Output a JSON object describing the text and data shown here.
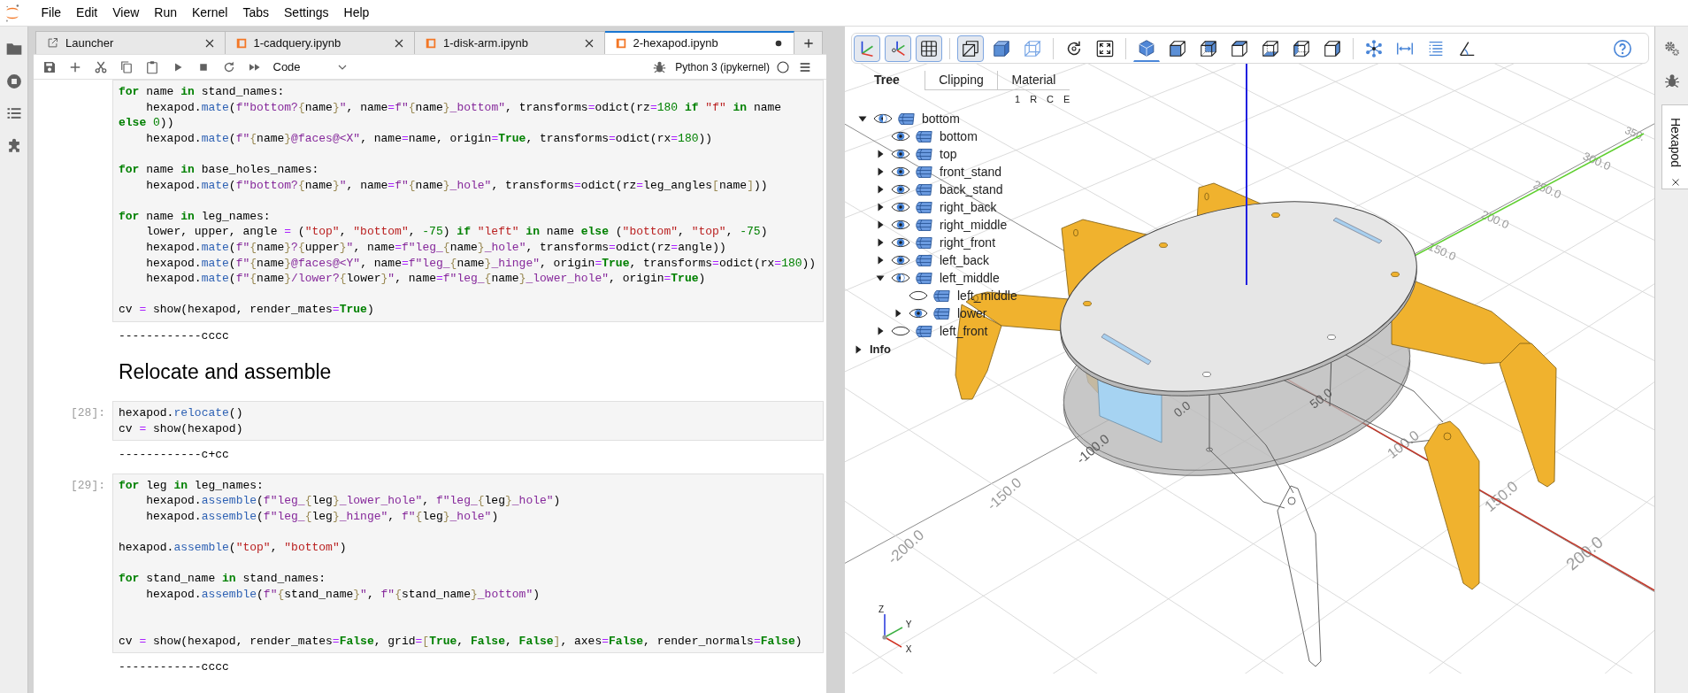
{
  "menu_bar": {
    "items": [
      "File",
      "Edit",
      "View",
      "Run",
      "Kernel",
      "Tabs",
      "Settings",
      "Help"
    ]
  },
  "left_sidebar": {
    "items": [
      {
        "kind": "files",
        "selected": false
      },
      {
        "kind": "running",
        "selected": false
      },
      {
        "kind": "toc",
        "selected": false
      },
      {
        "kind": "extensions",
        "selected": false
      }
    ]
  },
  "notebook_tabs": [
    {
      "kind": "launcher",
      "label": "Launcher",
      "selected": false,
      "modified": false
    },
    {
      "kind": "notebook",
      "label": "1-cadquery.ipynb",
      "selected": false,
      "modified": false
    },
    {
      "kind": "notebook",
      "label": "1-disk-arm.ipynb",
      "selected": false,
      "modified": false
    },
    {
      "kind": "notebook",
      "label": "2-hexapod.ipynb",
      "selected": true,
      "modified": true
    }
  ],
  "notebook_toolbar": {
    "cell_type": "Code",
    "kernel": {
      "name": "Python 3 (ipykernel)",
      "busy": false
    }
  },
  "cells": [
    {
      "kind": "code",
      "code": [
        {
          "kind": "keyword",
          "text": "for"
        },
        {
          "kind": "plain",
          "text": " name "
        },
        {
          "kind": "keyword",
          "text": "in"
        },
        {
          "kind": "plain",
          "text": " stand_names:\n    hexapod."
        },
        {
          "kind": "property",
          "text": "mate"
        },
        {
          "kind": "plain",
          "text": "("
        },
        {
          "kind": "fstring",
          "text": "f\"bottom?"
        },
        {
          "kind": "brace",
          "text": "{"
        },
        {
          "kind": "plain",
          "text": "name"
        },
        {
          "kind": "brace",
          "text": "}"
        },
        {
          "kind": "fstring",
          "text": "\""
        },
        {
          "kind": "plain",
          "text": ", name"
        },
        {
          "kind": "operator",
          "text": "="
        },
        {
          "kind": "fstring",
          "text": "f\""
        },
        {
          "kind": "brace",
          "text": "{"
        },
        {
          "kind": "plain",
          "text": "name"
        },
        {
          "kind": "brace",
          "text": "}"
        },
        {
          "kind": "fstring",
          "text": "_bottom\""
        },
        {
          "kind": "plain",
          "text": ", transforms"
        },
        {
          "kind": "operator",
          "text": "="
        },
        {
          "kind": "plain",
          "text": "odict(rz"
        },
        {
          "kind": "operator",
          "text": "="
        },
        {
          "kind": "number",
          "text": "180"
        },
        {
          "kind": "keyword",
          "text": " if "
        },
        {
          "kind": "string",
          "text": "\"f\""
        },
        {
          "kind": "keyword",
          "text": " in"
        },
        {
          "kind": "plain",
          "text": " name\n"
        },
        {
          "kind": "keyword",
          "text": "else "
        },
        {
          "kind": "number",
          "text": "0"
        },
        {
          "kind": "plain",
          "text": "))\n    hexapod."
        },
        {
          "kind": "property",
          "text": "mate"
        },
        {
          "kind": "plain",
          "text": "("
        },
        {
          "kind": "fstring",
          "text": "f\""
        },
        {
          "kind": "brace",
          "text": "{"
        },
        {
          "kind": "plain",
          "text": "name"
        },
        {
          "kind": "brace",
          "text": "}"
        },
        {
          "kind": "fstring",
          "text": "@faces@<X\""
        },
        {
          "kind": "plain",
          "text": ", name"
        },
        {
          "kind": "operator",
          "text": "="
        },
        {
          "kind": "plain",
          "text": "name, origin"
        },
        {
          "kind": "operator",
          "text": "="
        },
        {
          "kind": "keyword",
          "text": "True"
        },
        {
          "kind": "plain",
          "text": ", transforms"
        },
        {
          "kind": "operator",
          "text": "="
        },
        {
          "kind": "plain",
          "text": "odict(rx"
        },
        {
          "kind": "operator",
          "text": "="
        },
        {
          "kind": "number",
          "text": "180"
        },
        {
          "kind": "plain",
          "text": "))\n\n"
        },
        {
          "kind": "keyword",
          "text": "for"
        },
        {
          "kind": "plain",
          "text": " name "
        },
        {
          "kind": "keyword",
          "text": "in"
        },
        {
          "kind": "plain",
          "text": " base_holes_names:\n    hexapod."
        },
        {
          "kind": "property",
          "text": "mate"
        },
        {
          "kind": "plain",
          "text": "("
        },
        {
          "kind": "fstring",
          "text": "f\"bottom?"
        },
        {
          "kind": "brace",
          "text": "{"
        },
        {
          "kind": "plain",
          "text": "name"
        },
        {
          "kind": "brace",
          "text": "}"
        },
        {
          "kind": "fstring",
          "text": "\""
        },
        {
          "kind": "plain",
          "text": ", name"
        },
        {
          "kind": "operator",
          "text": "="
        },
        {
          "kind": "fstring",
          "text": "f\""
        },
        {
          "kind": "brace",
          "text": "{"
        },
        {
          "kind": "plain",
          "text": "name"
        },
        {
          "kind": "brace",
          "text": "}"
        },
        {
          "kind": "fstring",
          "text": "_hole\""
        },
        {
          "kind": "plain",
          "text": ", transforms"
        },
        {
          "kind": "operator",
          "text": "="
        },
        {
          "kind": "plain",
          "text": "odict(rz"
        },
        {
          "kind": "operator",
          "text": "="
        },
        {
          "kind": "plain",
          "text": "leg_angles"
        },
        {
          "kind": "brace",
          "text": "["
        },
        {
          "kind": "plain",
          "text": "name"
        },
        {
          "kind": "brace",
          "text": "]"
        },
        {
          "kind": "plain",
          "text": "))\n\n"
        },
        {
          "kind": "keyword",
          "text": "for"
        },
        {
          "kind": "plain",
          "text": " name "
        },
        {
          "kind": "keyword",
          "text": "in"
        },
        {
          "kind": "plain",
          "text": " leg_names:\n    lower, upper, angle "
        },
        {
          "kind": "operator",
          "text": "="
        },
        {
          "kind": "plain",
          "text": " ("
        },
        {
          "kind": "string",
          "text": "\"top\""
        },
        {
          "kind": "plain",
          "text": ", "
        },
        {
          "kind": "string",
          "text": "\"bottom\""
        },
        {
          "kind": "plain",
          "text": ", "
        },
        {
          "kind": "number",
          "text": "-75"
        },
        {
          "kind": "plain",
          "text": ") "
        },
        {
          "kind": "keyword",
          "text": "if "
        },
        {
          "kind": "string",
          "text": "\"left\""
        },
        {
          "kind": "keyword",
          "text": " in"
        },
        {
          "kind": "plain",
          "text": " name "
        },
        {
          "kind": "keyword",
          "text": "else"
        },
        {
          "kind": "plain",
          "text": " ("
        },
        {
          "kind": "string",
          "text": "\"bottom\""
        },
        {
          "kind": "plain",
          "text": ", "
        },
        {
          "kind": "string",
          "text": "\"top\""
        },
        {
          "kind": "plain",
          "text": ", "
        },
        {
          "kind": "number",
          "text": "-75"
        },
        {
          "kind": "plain",
          "text": ")\n    hexapod."
        },
        {
          "kind": "property",
          "text": "mate"
        },
        {
          "kind": "plain",
          "text": "("
        },
        {
          "kind": "fstring",
          "text": "f\""
        },
        {
          "kind": "brace",
          "text": "{"
        },
        {
          "kind": "plain",
          "text": "name"
        },
        {
          "kind": "brace",
          "text": "}"
        },
        {
          "kind": "fstring",
          "text": "?"
        },
        {
          "kind": "brace",
          "text": "{"
        },
        {
          "kind": "plain",
          "text": "upper"
        },
        {
          "kind": "brace",
          "text": "}"
        },
        {
          "kind": "fstring",
          "text": "\""
        },
        {
          "kind": "plain",
          "text": ", name"
        },
        {
          "kind": "operator",
          "text": "="
        },
        {
          "kind": "fstring",
          "text": "f\"leg_"
        },
        {
          "kind": "brace",
          "text": "{"
        },
        {
          "kind": "plain",
          "text": "name"
        },
        {
          "kind": "brace",
          "text": "}"
        },
        {
          "kind": "fstring",
          "text": "_hole\""
        },
        {
          "kind": "plain",
          "text": ", transforms"
        },
        {
          "kind": "operator",
          "text": "="
        },
        {
          "kind": "plain",
          "text": "odict(rz"
        },
        {
          "kind": "operator",
          "text": "="
        },
        {
          "kind": "plain",
          "text": "angle))\n    hexapod."
        },
        {
          "kind": "property",
          "text": "mate"
        },
        {
          "kind": "plain",
          "text": "("
        },
        {
          "kind": "fstring",
          "text": "f\""
        },
        {
          "kind": "brace",
          "text": "{"
        },
        {
          "kind": "plain",
          "text": "name"
        },
        {
          "kind": "brace",
          "text": "}"
        },
        {
          "kind": "fstring",
          "text": "@faces@<Y\""
        },
        {
          "kind": "plain",
          "text": ", name"
        },
        {
          "kind": "operator",
          "text": "="
        },
        {
          "kind": "fstring",
          "text": "f\"leg_"
        },
        {
          "kind": "brace",
          "text": "{"
        },
        {
          "kind": "plain",
          "text": "name"
        },
        {
          "kind": "brace",
          "text": "}"
        },
        {
          "kind": "fstring",
          "text": "_hinge\""
        },
        {
          "kind": "plain",
          "text": ", origin"
        },
        {
          "kind": "operator",
          "text": "="
        },
        {
          "kind": "keyword",
          "text": "True"
        },
        {
          "kind": "plain",
          "text": ", transforms"
        },
        {
          "kind": "operator",
          "text": "="
        },
        {
          "kind": "plain",
          "text": "odict(rx"
        },
        {
          "kind": "operator",
          "text": "="
        },
        {
          "kind": "number",
          "text": "180"
        },
        {
          "kind": "plain",
          "text": "))\n    hexapod."
        },
        {
          "kind": "property",
          "text": "mate"
        },
        {
          "kind": "plain",
          "text": "("
        },
        {
          "kind": "fstring",
          "text": "f\""
        },
        {
          "kind": "brace",
          "text": "{"
        },
        {
          "kind": "plain",
          "text": "name"
        },
        {
          "kind": "brace",
          "text": "}"
        },
        {
          "kind": "fstring",
          "text": "/lower?"
        },
        {
          "kind": "brace",
          "text": "{"
        },
        {
          "kind": "plain",
          "text": "lower"
        },
        {
          "kind": "brace",
          "text": "}"
        },
        {
          "kind": "fstring",
          "text": "\""
        },
        {
          "kind": "plain",
          "text": ", name"
        },
        {
          "kind": "operator",
          "text": "="
        },
        {
          "kind": "fstring",
          "text": "f\"leg_"
        },
        {
          "kind": "brace",
          "text": "{"
        },
        {
          "kind": "plain",
          "text": "name"
        },
        {
          "kind": "brace",
          "text": "}"
        },
        {
          "kind": "fstring",
          "text": "_lower_hole\""
        },
        {
          "kind": "plain",
          "text": ", origin"
        },
        {
          "kind": "operator",
          "text": "="
        },
        {
          "kind": "keyword",
          "text": "True"
        },
        {
          "kind": "plain",
          "text": ")\n\ncv "
        },
        {
          "kind": "operator",
          "text": "="
        },
        {
          "kind": "plain",
          "text": " show(hexapod, render_mates"
        },
        {
          "kind": "operator",
          "text": "="
        },
        {
          "kind": "keyword",
          "text": "True"
        },
        {
          "kind": "plain",
          "text": ")"
        }
      ],
      "output": "------------cccc"
    },
    {
      "kind": "markdown",
      "heading": "Relocate and assemble"
    },
    {
      "kind": "code",
      "prompt": "[28]:",
      "code": [
        {
          "kind": "plain",
          "text": "hexapod."
        },
        {
          "kind": "property",
          "text": "relocate"
        },
        {
          "kind": "plain",
          "text": "()\ncv "
        },
        {
          "kind": "operator",
          "text": "="
        },
        {
          "kind": "plain",
          "text": " show(hexapod)"
        }
      ],
      "output": "------------c+cc"
    },
    {
      "kind": "code",
      "prompt": "[29]:",
      "code": [
        {
          "kind": "keyword",
          "text": "for"
        },
        {
          "kind": "plain",
          "text": " leg "
        },
        {
          "kind": "keyword",
          "text": "in"
        },
        {
          "kind": "plain",
          "text": " leg_names:\n    hexapod."
        },
        {
          "kind": "property",
          "text": "assemble"
        },
        {
          "kind": "plain",
          "text": "("
        },
        {
          "kind": "fstring",
          "text": "f\"leg_"
        },
        {
          "kind": "brace",
          "text": "{"
        },
        {
          "kind": "plain",
          "text": "leg"
        },
        {
          "kind": "brace",
          "text": "}"
        },
        {
          "kind": "fstring",
          "text": "_lower_hole\""
        },
        {
          "kind": "plain",
          "text": ", "
        },
        {
          "kind": "fstring",
          "text": "f\"leg_"
        },
        {
          "kind": "brace",
          "text": "{"
        },
        {
          "kind": "plain",
          "text": "leg"
        },
        {
          "kind": "brace",
          "text": "}"
        },
        {
          "kind": "fstring",
          "text": "_hole\""
        },
        {
          "kind": "plain",
          "text": ")\n    hexapod."
        },
        {
          "kind": "property",
          "text": "assemble"
        },
        {
          "kind": "plain",
          "text": "("
        },
        {
          "kind": "fstring",
          "text": "f\"leg_"
        },
        {
          "kind": "brace",
          "text": "{"
        },
        {
          "kind": "plain",
          "text": "leg"
        },
        {
          "kind": "brace",
          "text": "}"
        },
        {
          "kind": "fstring",
          "text": "_hinge\""
        },
        {
          "kind": "plain",
          "text": ", "
        },
        {
          "kind": "fstring",
          "text": "f\""
        },
        {
          "kind": "brace",
          "text": "{"
        },
        {
          "kind": "plain",
          "text": "leg"
        },
        {
          "kind": "brace",
          "text": "}"
        },
        {
          "kind": "fstring",
          "text": "_hole\""
        },
        {
          "kind": "plain",
          "text": ")\n\nhexapod."
        },
        {
          "kind": "property",
          "text": "assemble"
        },
        {
          "kind": "plain",
          "text": "("
        },
        {
          "kind": "string",
          "text": "\"top\""
        },
        {
          "kind": "plain",
          "text": ", "
        },
        {
          "kind": "string",
          "text": "\"bottom\""
        },
        {
          "kind": "plain",
          "text": ")\n\n"
        },
        {
          "kind": "keyword",
          "text": "for"
        },
        {
          "kind": "plain",
          "text": " stand_name "
        },
        {
          "kind": "keyword",
          "text": "in"
        },
        {
          "kind": "plain",
          "text": " stand_names:\n    hexapod."
        },
        {
          "kind": "property",
          "text": "assemble"
        },
        {
          "kind": "plain",
          "text": "("
        },
        {
          "kind": "fstring",
          "text": "f\""
        },
        {
          "kind": "brace",
          "text": "{"
        },
        {
          "kind": "plain",
          "text": "stand_name"
        },
        {
          "kind": "brace",
          "text": "}"
        },
        {
          "kind": "fstring",
          "text": "\""
        },
        {
          "kind": "plain",
          "text": ", "
        },
        {
          "kind": "fstring",
          "text": "f\""
        },
        {
          "kind": "brace",
          "text": "{"
        },
        {
          "kind": "plain",
          "text": "stand_name"
        },
        {
          "kind": "brace",
          "text": "}"
        },
        {
          "kind": "fstring",
          "text": "_bottom\""
        },
        {
          "kind": "plain",
          "text": ")\n\n\ncv "
        },
        {
          "kind": "operator",
          "text": "="
        },
        {
          "kind": "plain",
          "text": " show(hexapod, render_mates"
        },
        {
          "kind": "operator",
          "text": "="
        },
        {
          "kind": "keyword",
          "text": "False"
        },
        {
          "kind": "plain",
          "text": ", grid"
        },
        {
          "kind": "operator",
          "text": "="
        },
        {
          "kind": "brace",
          "text": "["
        },
        {
          "kind": "keyword",
          "text": "True"
        },
        {
          "kind": "plain",
          "text": ", "
        },
        {
          "kind": "keyword",
          "text": "False"
        },
        {
          "kind": "plain",
          "text": ", "
        },
        {
          "kind": "keyword",
          "text": "False"
        },
        {
          "kind": "brace",
          "text": "]"
        },
        {
          "kind": "plain",
          "text": ", axes"
        },
        {
          "kind": "operator",
          "text": "="
        },
        {
          "kind": "keyword",
          "text": "False"
        },
        {
          "kind": "plain",
          "text": ", render_normals"
        },
        {
          "kind": "operator",
          "text": "="
        },
        {
          "kind": "keyword",
          "text": "False"
        },
        {
          "kind": "plain",
          "text": ")"
        }
      ],
      "output": "------------cccc"
    }
  ],
  "viewer": {
    "toolbar": {
      "groups": [
        [
          {
            "kind": "axes",
            "on": true
          },
          {
            "kind": "axes0",
            "on": true
          },
          {
            "kind": "grid",
            "on": true
          }
        ],
        [
          {
            "kind": "perspective",
            "on": true
          },
          {
            "kind": "transparent",
            "on": false
          },
          {
            "kind": "edges",
            "on": false
          }
        ],
        [
          {
            "kind": "reset"
          },
          {
            "kind": "fit"
          }
        ],
        [
          {
            "kind": "iso",
            "selected": true
          },
          {
            "kind": "front",
            "selected": false
          },
          {
            "kind": "rear",
            "selected": false
          },
          {
            "kind": "top",
            "selected": false
          },
          {
            "kind": "bottom",
            "selected": false
          },
          {
            "kind": "left",
            "selected": false
          },
          {
            "kind": "right",
            "selected": false
          }
        ],
        [
          {
            "kind": "explode"
          },
          {
            "kind": "distance"
          },
          {
            "kind": "properties"
          },
          {
            "kind": "angle"
          }
        ]
      ],
      "help": {
        "kind": "help"
      }
    },
    "tree_tabs": [
      {
        "label": "Tree",
        "selected": true
      },
      {
        "label": "Clipping",
        "selected": false
      },
      {
        "label": "Material",
        "selected": false
      }
    ],
    "tree_buttons": [
      "1",
      "R",
      "C",
      "E"
    ],
    "tree": [
      {
        "label": "bottom",
        "expanded": true,
        "visible": true,
        "mixed": true,
        "children": [
          {
            "label": "bottom",
            "visible": true,
            "mixed": false
          },
          {
            "label": "top",
            "expanded": false,
            "visible": true,
            "mixed": false
          },
          {
            "label": "front_stand",
            "expanded": false,
            "visible": true,
            "mixed": false
          },
          {
            "label": "back_stand",
            "expanded": false,
            "visible": true,
            "mixed": false
          },
          {
            "label": "right_back",
            "expanded": false,
            "visible": true,
            "mixed": false
          },
          {
            "label": "right_middle",
            "expanded": false,
            "visible": true,
            "mixed": false
          },
          {
            "label": "right_front",
            "expanded": false,
            "visible": true,
            "mixed": false
          },
          {
            "label": "left_back",
            "expanded": false,
            "visible": true,
            "mixed": false
          },
          {
            "label": "left_middle",
            "expanded": true,
            "visible": true,
            "mixed": true,
            "children": [
              {
                "label": "left_middle",
                "visible": false,
                "mixed": false
              },
              {
                "label": "lower",
                "expanded": false,
                "visible": true,
                "mixed": false
              }
            ]
          },
          {
            "label": "left_front",
            "expanded": false,
            "visible": false,
            "mixed": false
          }
        ]
      }
    ],
    "info": {
      "label": "Info",
      "expanded": false
    },
    "grid_labels": [
      "-200.0",
      "-150.0",
      "-100.0",
      "0.0",
      "50.0",
      "100.0",
      "150.0",
      "200.0",
      "150.0",
      "200.0",
      "250.0",
      "300.0",
      "350."
    ],
    "orientation_labels": [
      "Z",
      "Y",
      "X"
    ]
  },
  "right_sidebar": {
    "items": [
      {
        "kind": "property_inspector",
        "selected": false
      },
      {
        "kind": "debugger",
        "selected": false
      }
    ],
    "tabs": [
      {
        "label": "Hexapod",
        "selected": true
      }
    ]
  }
}
